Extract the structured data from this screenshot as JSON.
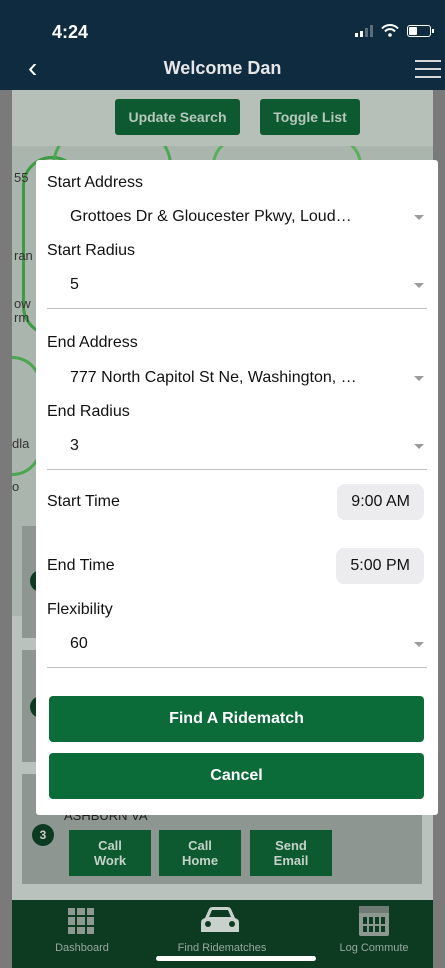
{
  "status_bar": {
    "time": "4:24"
  },
  "nav": {
    "title": "Welcome Dan"
  },
  "toolbar": {
    "update_search": "Update Search",
    "toggle_list": "Toggle List"
  },
  "background": {
    "card_numbers": [
      "3"
    ],
    "card_city": "ASHBURN VA",
    "contact_buttons": [
      "Call\nWork",
      "Call\nHome",
      "Send\nEmail"
    ]
  },
  "form": {
    "start_address_label": "Start Address",
    "start_address_value": "Grottoes Dr & Gloucester Pkwy, Loud…",
    "start_radius_label": "Start Radius",
    "start_radius_value": "5",
    "end_address_label": "End Address",
    "end_address_value": "777 North Capitol St Ne, Washington, …",
    "end_radius_label": "End Radius",
    "end_radius_value": "3",
    "start_time_label": "Start Time",
    "start_time_value": "9:00 AM",
    "end_time_label": "End Time",
    "end_time_value": "5:00 PM",
    "flexibility_label": "Flexibility",
    "flexibility_value": "60",
    "find_button": "Find A Ridematch",
    "cancel_button": "Cancel"
  },
  "tabs": [
    {
      "label": "Dashboard",
      "icon": "grid-icon"
    },
    {
      "label": "Find Ridematches",
      "icon": "car-icon"
    },
    {
      "label": "Log Commute",
      "icon": "calendar-icon"
    }
  ],
  "colors": {
    "header": "#0e2b40",
    "primary_green": "#0b6b39",
    "tab_bar": "#0c3b22"
  }
}
